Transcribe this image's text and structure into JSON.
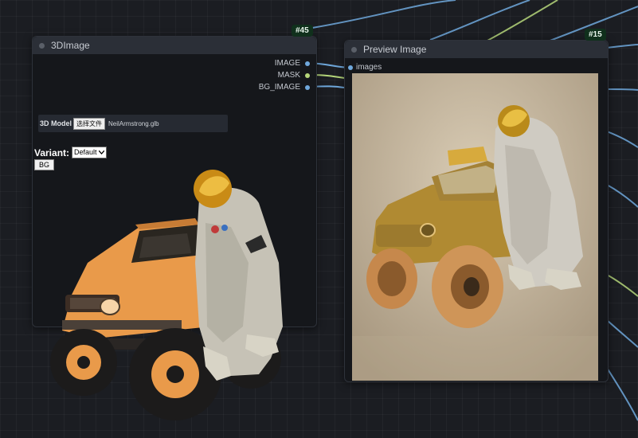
{
  "node_3d": {
    "title": "3DImage",
    "badge": "#45",
    "outputs": [
      {
        "label": "IMAGE",
        "color": "#6fa8dc"
      },
      {
        "label": "MASK",
        "color": "#b5d67a"
      },
      {
        "label": "BG_IMAGE",
        "color": "#6fa8dc"
      }
    ],
    "model_label": "3D Model",
    "file_button": "选择文件",
    "file_name": "NeilArmstrong.glb",
    "variant_label": "Variant:",
    "variant_value": "Default",
    "bg_button": "BG"
  },
  "node_preview": {
    "title": "Preview Image",
    "badge": "#15",
    "input": {
      "label": "images",
      "color": "#6fa8dc"
    }
  },
  "colors": {
    "canvas_bg": "#1b1d22",
    "node_body": "#15171b",
    "node_header": "#2b2f37",
    "badge_bg": "#10301c",
    "wire_blue": "#6fa8dc",
    "wire_green": "#b5d67a"
  }
}
